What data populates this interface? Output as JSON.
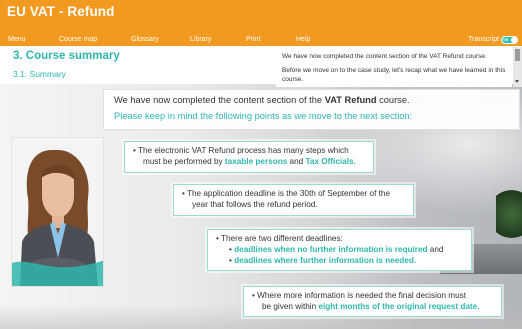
{
  "app": {
    "title": "EU VAT - Refund"
  },
  "menu": {
    "items": [
      "Menu",
      "Course map",
      "Glossary",
      "Library",
      "Print",
      "Help"
    ],
    "transcript_label": "Transcript",
    "toggle_label": "on"
  },
  "section": {
    "heading": "3. Course summary",
    "subheading": "3.1. Summary"
  },
  "transcript_panel": {
    "lines": [
      "We have now completed the content section of the VAT Refund course.",
      "Before we move on to the case study, let's recap what we have learned in this course."
    ]
  },
  "intro": {
    "line1_prefix": "We have now completed the content section of the ",
    "line1_bold": "VAT Refund",
    "line1_suffix": " course.",
    "line2": "Please keep in mind the following points as we move to the next section:"
  },
  "cards": [
    {
      "pre": "• The electronic VAT Refund process has many steps which",
      "line2_pre": "must be performed by ",
      "hl1": "taxable persons",
      "mid": " and ",
      "hl2": "Tax Officials",
      "post": "."
    },
    {
      "line1": "• The application deadline is the 30th of September of the",
      "line2": "year that follows the refund period."
    },
    {
      "line1": "• There are two different deadlines:",
      "sub1_hl": "deadlines when no further information is required",
      "sub1_post": " and",
      "sub2_hl": "deadlines where further information is needed."
    },
    {
      "line1": "• Where more information is needed the final decision must",
      "line2_pre": "be given within ",
      "line2_hl": "eight months of the original request date",
      "line2_post": "."
    }
  ],
  "colors": {
    "brand_orange": "#f29a1f",
    "accent_teal": "#2fb7ad"
  }
}
